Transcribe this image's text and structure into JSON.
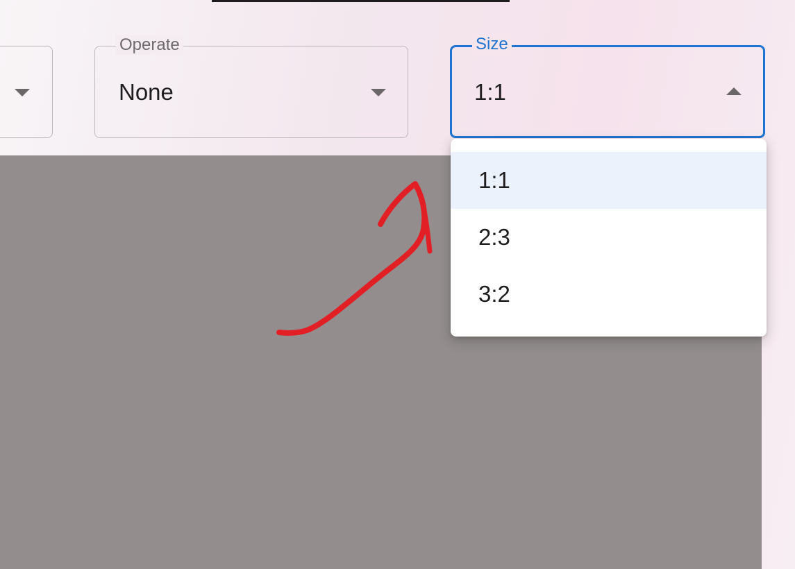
{
  "fields": {
    "left_field": {
      "value": ""
    },
    "operate": {
      "label": "Operate",
      "value": "None"
    },
    "size": {
      "label": "Size",
      "value": "1:1"
    }
  },
  "size_menu": {
    "options": [
      "1:1",
      "2:3",
      "3:2"
    ],
    "selected": "1:1"
  },
  "colors": {
    "focus_accent": "#1f74d1",
    "selected_option_bg": "#ebf2fb",
    "canvas_bg": "#938e8d",
    "annotation_stroke": "#e21f25"
  }
}
